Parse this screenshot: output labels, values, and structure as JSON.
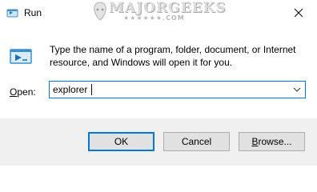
{
  "window": {
    "title": "Run",
    "icon": "run-app-icon",
    "close_icon": "close-icon"
  },
  "watermark": {
    "text": "MAJORGEEKS",
    "subtext": "★★★★★★.COM"
  },
  "dialog": {
    "icon": "run-dialog-icon",
    "description": "Type the name of a program, folder, document, or Internet resource, and Windows will open it for you.",
    "open_label_prefix": "O",
    "open_label_rest": "pen:",
    "open_value": "explorer",
    "dropdown_icon": "chevron-down-icon"
  },
  "buttons": {
    "ok": "OK",
    "cancel": "Cancel",
    "browse_prefix": "B",
    "browse_rest": "rowse..."
  },
  "colors": {
    "accent": "#0078d7",
    "footer_bg": "#f0f0f0",
    "button_bg": "#e1e1e1"
  }
}
